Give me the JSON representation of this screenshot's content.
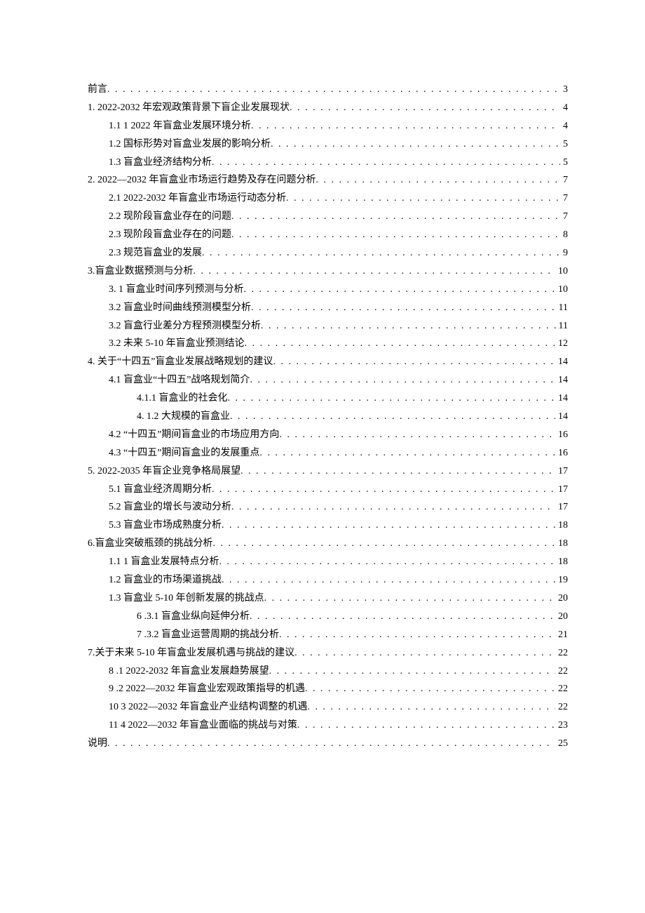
{
  "toc": [
    {
      "indent": 0,
      "label": "前言",
      "page": "3"
    },
    {
      "indent": 0,
      "label": "1.   2022-2032 年宏观政策背景下盲企业发展现状",
      "page": "4"
    },
    {
      "indent": 1,
      "label": "1.1 1 2022 年盲盒业发展环境分析",
      "page": "4"
    },
    {
      "indent": 1,
      "label": "1.2     国标形势对盲盒业发展的影响分析",
      "page": "5"
    },
    {
      "indent": 1,
      "label": "1.3     盲盒业经济结构分析",
      "page": "5"
    },
    {
      "indent": 0,
      "label": "2.   2022—2032 年盲盒业市场运行趋势及存在问题分析",
      "page": "7"
    },
    {
      "indent": 1,
      "label": "2.1     2022-2032 年盲盒业市场运行动态分析",
      "page": "7"
    },
    {
      "indent": 1,
      "label": "2.2 现阶段盲盒业存在的问题",
      "page": "7"
    },
    {
      "indent": 1,
      "label": "2.3 现阶段盲盒业存在的问题",
      "page": "8"
    },
    {
      "indent": 1,
      "label": "2.3 规范盲盒业的发展",
      "page": "9"
    },
    {
      "indent": 0,
      "label": "3.盲盒业数据预测与分析",
      "page": "10"
    },
    {
      "indent": 1,
      "label": "3.    1 盲盒业时间序列预测与分析",
      "page": "10"
    },
    {
      "indent": 1,
      "label": "3.2 盲盒业时间曲线预测模型分析",
      "page": "11"
    },
    {
      "indent": 1,
      "label": "3.2 盲盒行业差分方程预测模型分析",
      "page": "11"
    },
    {
      "indent": 1,
      "label": "3.2 未来 5-10 年盲盒业预测结论",
      "page": "12"
    },
    {
      "indent": 0,
      "label": "4.   关于“十四五”盲盒业发展战略规划的建议",
      "page": "14"
    },
    {
      "indent": 1,
      "label": "4.1 盲盒业“十四五”战咯规划简介",
      "page": "14"
    },
    {
      "indent": 2,
      "label": "4.1.1 盲盒业的社会化",
      "page": "14"
    },
    {
      "indent": 2,
      "label": "4.   1.2 大规模的盲盒业",
      "page": "14"
    },
    {
      "indent": 1,
      "label": "4.2    “十四五”期间盲盒业的市场应用方向",
      "page": "16"
    },
    {
      "indent": 1,
      "label": "4.3    “十四五”期间盲盒业的发展重点",
      "page": "16"
    },
    {
      "indent": 0,
      "label": "5.   2022-2035 年盲企业竞争格局展望",
      "page": "17"
    },
    {
      "indent": 1,
      "label": "5.1 盲盒业经济周期分析",
      "page": "17"
    },
    {
      "indent": 1,
      "label": "5.2     盲盒业的增长与波动分析",
      "page": "17"
    },
    {
      "indent": 1,
      "label": "5.3     盲盒业市场成熟度分析",
      "page": "18"
    },
    {
      "indent": 0,
      "label": "6.盲盒业突破瓶颈的挑战分析",
      "page": "18"
    },
    {
      "indent": 1,
      "label": "1.1 1 盲盒业发展特点分析",
      "page": "18"
    },
    {
      "indent": 1,
      "label": "1.2        盲盒业的市场渠道挑战",
      "page": "19"
    },
    {
      "indent": 1,
      "label": "1.3        盲盒业 5-10 年创新发展的挑战点",
      "page": "20"
    },
    {
      "indent": 2,
      "label": "6   .3.1 盲盒业纵向延伸分析",
      "page": "20"
    },
    {
      "indent": 2,
      "label": "7   .3.2 盲盒业运营周期的挑战分析",
      "page": "21"
    },
    {
      "indent": 0,
      "label": "7.关于未来 5-10 年盲盒业发展机遇与挑战的建议",
      "page": "22"
    },
    {
      "indent": 1,
      "label": "8   .1 2022-2032 年盲盒业发展趋势展望",
      "page": "22"
    },
    {
      "indent": 1,
      "label": "9   .2 2022—2032 年盲盒业宏观政策指导的机遇",
      "page": "22"
    },
    {
      "indent": 1,
      "label": "10  3 2022—2032 年盲盒业产业结构调整的机遇",
      "page": "22"
    },
    {
      "indent": 1,
      "label": "11  4 2022—2032 年盲盒业面临的挑战与对策",
      "page": "23"
    },
    {
      "indent": 0,
      "label": "说明",
      "page": "25"
    }
  ]
}
